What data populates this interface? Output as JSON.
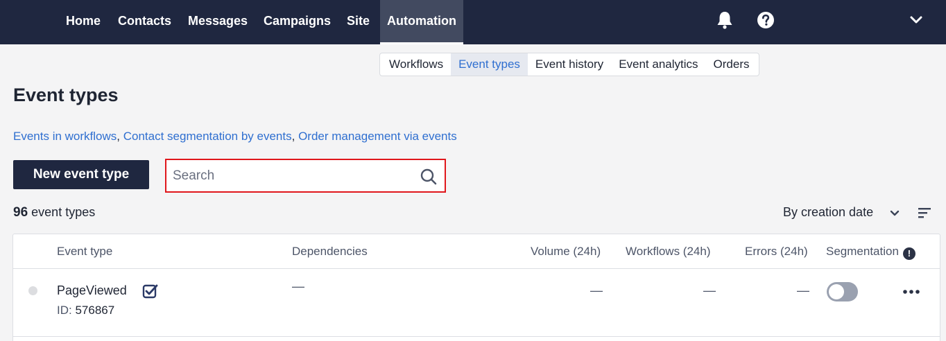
{
  "nav": {
    "items": [
      {
        "label": "Home"
      },
      {
        "label": "Contacts"
      },
      {
        "label": "Messages"
      },
      {
        "label": "Campaigns"
      },
      {
        "label": "Site"
      },
      {
        "label": "Automation"
      }
    ],
    "active": "Automation",
    "icons": [
      "bell-icon",
      "help-icon",
      "chevron-down-icon"
    ]
  },
  "subtabs": {
    "items": [
      {
        "label": "Workflows"
      },
      {
        "label": "Event types"
      },
      {
        "label": "Event history"
      },
      {
        "label": "Event analytics"
      },
      {
        "label": "Orders"
      }
    ],
    "active": "Event types"
  },
  "page": {
    "title": "Event types",
    "links": [
      {
        "label": "Events in workflows"
      },
      {
        "label": "Contact segmentation by events"
      },
      {
        "label": "Order management via events"
      }
    ],
    "link_separator": ", "
  },
  "toolbar": {
    "new_button": "New event type",
    "search_placeholder": "Search",
    "search_value": ""
  },
  "summary": {
    "count": "96",
    "count_suffix": "event types",
    "sort_label": "By creation date"
  },
  "table": {
    "columns": [
      "Event type",
      "Dependencies",
      "Volume (24h)",
      "Workflows (24h)",
      "Errors (24h)",
      "Segmentation"
    ],
    "rows": [
      {
        "name": "PageViewed",
        "id_label": "ID:",
        "id": "576867",
        "dependencies": "—",
        "volume": "—",
        "workflows": "—",
        "errors": "—",
        "segmentation_enabled": false
      }
    ]
  },
  "colors": {
    "nav_bg": "#1f2740",
    "link": "#2f6fd0",
    "highlight_border": "#e0161b"
  }
}
